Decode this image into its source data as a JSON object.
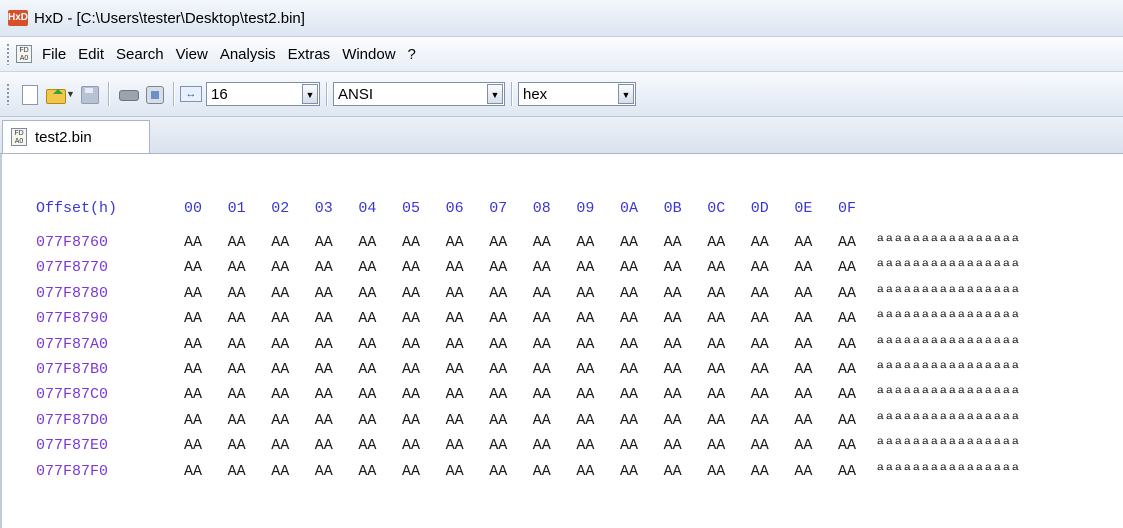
{
  "window": {
    "title": "HxD - [C:\\Users\\tester\\Desktop\\test2.bin]",
    "icon": "hxd-app-icon"
  },
  "menu": {
    "items": [
      "File",
      "Edit",
      "Search",
      "View",
      "Analysis",
      "Extras",
      "Window",
      "?"
    ]
  },
  "toolbar": {
    "bytes_per_row": "16",
    "charset": "ANSI",
    "offset_base": "hex"
  },
  "tabs": [
    {
      "label": "test2.bin",
      "icon": "hex-document-icon"
    }
  ],
  "hex": {
    "offset_label": "Offset(h)",
    "columns": [
      "00",
      "01",
      "02",
      "03",
      "04",
      "05",
      "06",
      "07",
      "08",
      "09",
      "0A",
      "0B",
      "0C",
      "0D",
      "0E",
      "0F"
    ],
    "rows": [
      {
        "offset": "077F8760",
        "bytes": [
          "AA",
          "AA",
          "AA",
          "AA",
          "AA",
          "AA",
          "AA",
          "AA",
          "AA",
          "AA",
          "AA",
          "AA",
          "AA",
          "AA",
          "AA",
          "AA"
        ],
        "ascii": "ªªªªªªªªªªªªªªªª"
      },
      {
        "offset": "077F8770",
        "bytes": [
          "AA",
          "AA",
          "AA",
          "AA",
          "AA",
          "AA",
          "AA",
          "AA",
          "AA",
          "AA",
          "AA",
          "AA",
          "AA",
          "AA",
          "AA",
          "AA"
        ],
        "ascii": "ªªªªªªªªªªªªªªªª"
      },
      {
        "offset": "077F8780",
        "bytes": [
          "AA",
          "AA",
          "AA",
          "AA",
          "AA",
          "AA",
          "AA",
          "AA",
          "AA",
          "AA",
          "AA",
          "AA",
          "AA",
          "AA",
          "AA",
          "AA"
        ],
        "ascii": "ªªªªªªªªªªªªªªªª"
      },
      {
        "offset": "077F8790",
        "bytes": [
          "AA",
          "AA",
          "AA",
          "AA",
          "AA",
          "AA",
          "AA",
          "AA",
          "AA",
          "AA",
          "AA",
          "AA",
          "AA",
          "AA",
          "AA",
          "AA"
        ],
        "ascii": "ªªªªªªªªªªªªªªªª"
      },
      {
        "offset": "077F87A0",
        "bytes": [
          "AA",
          "AA",
          "AA",
          "AA",
          "AA",
          "AA",
          "AA",
          "AA",
          "AA",
          "AA",
          "AA",
          "AA",
          "AA",
          "AA",
          "AA",
          "AA"
        ],
        "ascii": "ªªªªªªªªªªªªªªªª"
      },
      {
        "offset": "077F87B0",
        "bytes": [
          "AA",
          "AA",
          "AA",
          "AA",
          "AA",
          "AA",
          "AA",
          "AA",
          "AA",
          "AA",
          "AA",
          "AA",
          "AA",
          "AA",
          "AA",
          "AA"
        ],
        "ascii": "ªªªªªªªªªªªªªªªª"
      },
      {
        "offset": "077F87C0",
        "bytes": [
          "AA",
          "AA",
          "AA",
          "AA",
          "AA",
          "AA",
          "AA",
          "AA",
          "AA",
          "AA",
          "AA",
          "AA",
          "AA",
          "AA",
          "AA",
          "AA"
        ],
        "ascii": "ªªªªªªªªªªªªªªªª"
      },
      {
        "offset": "077F87D0",
        "bytes": [
          "AA",
          "AA",
          "AA",
          "AA",
          "AA",
          "AA",
          "AA",
          "AA",
          "AA",
          "AA",
          "AA",
          "AA",
          "AA",
          "AA",
          "AA",
          "AA"
        ],
        "ascii": "ªªªªªªªªªªªªªªªª"
      },
      {
        "offset": "077F87E0",
        "bytes": [
          "AA",
          "AA",
          "AA",
          "AA",
          "AA",
          "AA",
          "AA",
          "AA",
          "AA",
          "AA",
          "AA",
          "AA",
          "AA",
          "AA",
          "AA",
          "AA"
        ],
        "ascii": "ªªªªªªªªªªªªªªªª"
      },
      {
        "offset": "077F87F0",
        "bytes": [
          "AA",
          "AA",
          "AA",
          "AA",
          "AA",
          "AA",
          "AA",
          "AA",
          "AA",
          "AA",
          "AA",
          "AA",
          "AA",
          "AA",
          "AA",
          "AA"
        ],
        "ascii": "ªªªªªªªªªªªªªªªª"
      }
    ]
  },
  "colors": {
    "offset_text": "#7a3ad6",
    "header_text": "#3a36d6",
    "byte_text": "#1a1a1a"
  }
}
